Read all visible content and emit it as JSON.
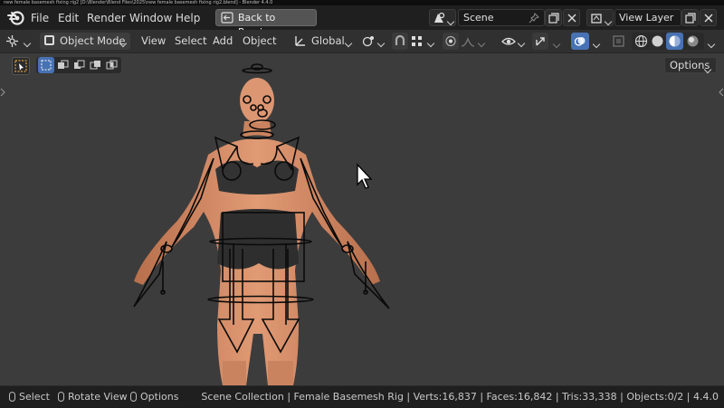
{
  "window": {
    "title": "new female basemesh fixing rig2 [D:\\Blender\\Blend Files\\2025\\new female basemesh fixing rig2.blend] - Blender 4.4.0"
  },
  "menu": {
    "file": "File",
    "edit": "Edit",
    "render": "Render",
    "window": "Window",
    "help": "Help"
  },
  "back_button": "Back to Previous",
  "scene": {
    "name": "Scene",
    "view_layer": "View Layer"
  },
  "header": {
    "mode": "Object Mode",
    "view": "View",
    "select": "Select",
    "add": "Add",
    "object": "Object",
    "orientation": "Global"
  },
  "viewport": {
    "options": "Options"
  },
  "status": {
    "select": "Select",
    "rotate_view": "Rotate View",
    "options": "Options",
    "stats": "Scene Collection | Female Basemesh Rig | Verts:16,837 | Faces:16,842 | Tris:33,338 | Objects:0/2 | 4.4.0"
  },
  "colors": {
    "accent": "#4772b3",
    "viewport_bg": "#3c3c3c",
    "header_bg": "#303030",
    "skin": "#d9916b"
  },
  "icons": [
    "blender-logo-icon",
    "back-to-previous-icon",
    "scene-icon",
    "pin-icon",
    "duplicate-icon",
    "close-icon",
    "view-layer-icon",
    "editor-type-icon",
    "object-mode-cube-icon",
    "transform-orientation-icon",
    "pivot-point-icon",
    "snap-icon",
    "proportional-edit-icon",
    "visibility-icon",
    "gizmo-icon",
    "overlay-icon",
    "xray-icon",
    "shading-wireframe-icon",
    "shading-solid-icon",
    "shading-material-icon",
    "shading-rendered-icon",
    "select-box-tool-icon",
    "mouse-left-icon",
    "mouse-middle-icon",
    "mouse-right-icon",
    "mouse-cursor-icon"
  ]
}
